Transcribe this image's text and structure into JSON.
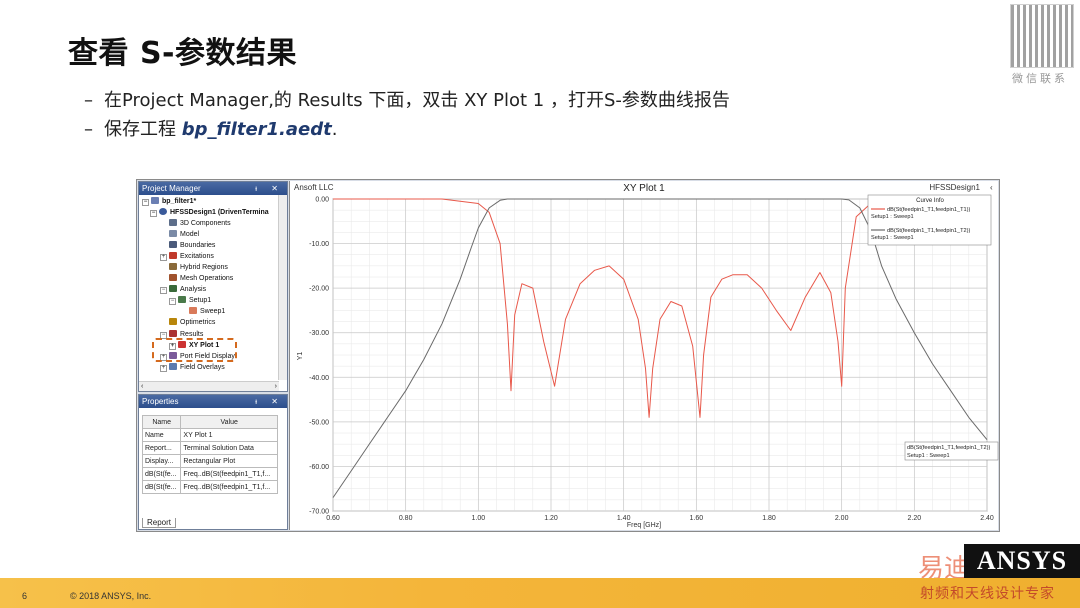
{
  "slide": {
    "title": "查看 S-参数结果",
    "bullet1": "在Project Manager,的 Results 下面，双击 XY Plot 1 ，打开S-参数曲线报告",
    "bullet2_prefix": "保存工程 ",
    "bullet2_file": "bp_filter1.aedt",
    "bullet2_suffix": ".",
    "dash": "–"
  },
  "watermark": {
    "wechat": "微信联系",
    "brand_cn": "易迪",
    "tagline": "射频和天线设计专家"
  },
  "footer": {
    "page": "6",
    "copyright": "© 2018 ANSYS, Inc.",
    "logo": "ANSYS"
  },
  "project_manager": {
    "title": "Project Manager",
    "controls": "ᵼ ✕",
    "tree": [
      {
        "label": "bp_filter1*",
        "bold": true,
        "icon": "project-icon"
      },
      {
        "label": "HFSSDesign1 (DrivenTermina",
        "bold": true,
        "icon": "design-icon"
      },
      {
        "label": "3D Components",
        "icon": "components-icon"
      },
      {
        "label": "Model",
        "icon": "model-icon"
      },
      {
        "label": "Boundaries",
        "icon": "boundaries-icon"
      },
      {
        "label": "Excitations",
        "icon": "excitations-icon"
      },
      {
        "label": "Hybrid Regions",
        "icon": "hybrid-icon"
      },
      {
        "label": "Mesh Operations",
        "icon": "mesh-icon"
      },
      {
        "label": "Analysis",
        "icon": "analysis-icon"
      },
      {
        "label": "Setup1",
        "icon": "setup-icon"
      },
      {
        "label": "Sweep1",
        "icon": "sweep-icon"
      },
      {
        "label": "Optimetrics",
        "icon": "optimetrics-icon"
      },
      {
        "label": "Results",
        "icon": "results-icon"
      },
      {
        "label": "XY Plot 1",
        "bold": true,
        "icon": "xyplot-icon"
      },
      {
        "label": "Port Field Display",
        "icon": "portfield-icon"
      },
      {
        "label": "Field Overlays",
        "icon": "fieldoverlay-icon"
      }
    ]
  },
  "properties": {
    "title": "Properties",
    "controls": "ᵼ ✕",
    "headers": [
      "Name",
      "Value"
    ],
    "rows": [
      [
        "Name",
        "XY Plot 1"
      ],
      [
        "Report...",
        "Terminal Solution Data"
      ],
      [
        "Display...",
        "Rectangular Plot"
      ],
      [
        "dB(St(fe...",
        "Freq..dB(St(feedpin1_T1,f..."
      ],
      [
        "dB(St(fe...",
        "Freq..dB(St(feedpin1_T1,f..."
      ]
    ],
    "tab": "Report"
  },
  "plot": {
    "brand": "Ansoft LLC",
    "design": "HFSSDesign1",
    "legend_title": "Curve Info",
    "legend_items": [
      {
        "name": "dB(St(feedpin1_T1,feedpin1_T1))",
        "sub": "Setup1 : Sweep1",
        "color": "#e8584a"
      },
      {
        "name": "dB(St(feedpin1_T1,feedpin1_T2))",
        "sub": "Setup1 : Sweep1",
        "color": "#6a6a6a"
      }
    ],
    "marker_label": {
      "name": "dB(St(feedpin1_T1,feedpin1_T2))",
      "sub": "Setup1 : Sweep1"
    }
  },
  "chart_data": {
    "type": "line",
    "title": "XY Plot 1",
    "xlabel": "Freq [GHz]",
    "ylabel": "Y1",
    "xlim": [
      0.6,
      2.4
    ],
    "ylim": [
      -70,
      0
    ],
    "xticks": [
      "0.60",
      "0.80",
      "1.00",
      "1.20",
      "1.40",
      "1.60",
      "1.80",
      "2.00",
      "2.20",
      "2.40"
    ],
    "yticks": [
      "0.00",
      "-10.00",
      "-20.00",
      "-30.00",
      "-40.00",
      "-50.00",
      "-60.00",
      "-70.00"
    ],
    "grid": true,
    "legend": "top-right",
    "series": [
      {
        "name": "dB(St(feedpin1_T1,feedpin1_T1))",
        "color": "#e8584a",
        "x": [
          0.6,
          0.9,
          1.0,
          1.03,
          1.06,
          1.08,
          1.09,
          1.1,
          1.12,
          1.15,
          1.18,
          1.21,
          1.24,
          1.28,
          1.32,
          1.36,
          1.4,
          1.44,
          1.46,
          1.47,
          1.48,
          1.5,
          1.53,
          1.56,
          1.59,
          1.61,
          1.62,
          1.64,
          1.67,
          1.7,
          1.74,
          1.78,
          1.82,
          1.86,
          1.9,
          1.94,
          1.97,
          1.99,
          2.0,
          2.01,
          2.04,
          2.08,
          2.2,
          2.4
        ],
        "y": [
          0,
          0,
          -1,
          -3,
          -10,
          -28,
          -43,
          -26,
          -19,
          -20,
          -32,
          -42,
          -27,
          -19,
          -16,
          -15,
          -18,
          -27,
          -38,
          -49,
          -38,
          -27,
          -23,
          -24,
          -33,
          -49,
          -35,
          -22,
          -18,
          -17,
          -17,
          -20,
          -25,
          -29.5,
          -22,
          -16.5,
          -21,
          -32,
          -42,
          -20,
          -4,
          -1,
          0,
          0
        ]
      },
      {
        "name": "dB(St(feedpin1_T1,feedpin1_T2))",
        "color": "#6a6a6a",
        "x": [
          0.6,
          0.65,
          0.7,
          0.75,
          0.8,
          0.85,
          0.9,
          0.95,
          0.98,
          1.0,
          1.03,
          1.06,
          1.08,
          1.1,
          2.0,
          2.02,
          2.05,
          2.08,
          2.11,
          2.15,
          2.2,
          2.25,
          2.3,
          2.35,
          2.4
        ],
        "y": [
          -67,
          -61,
          -55,
          -49,
          -43,
          -36,
          -28,
          -18,
          -11,
          -6.5,
          -2,
          -0.3,
          0,
          0,
          0,
          -0.2,
          -2,
          -7,
          -15,
          -22.5,
          -30,
          -37,
          -43,
          -49,
          -54
        ]
      }
    ]
  }
}
